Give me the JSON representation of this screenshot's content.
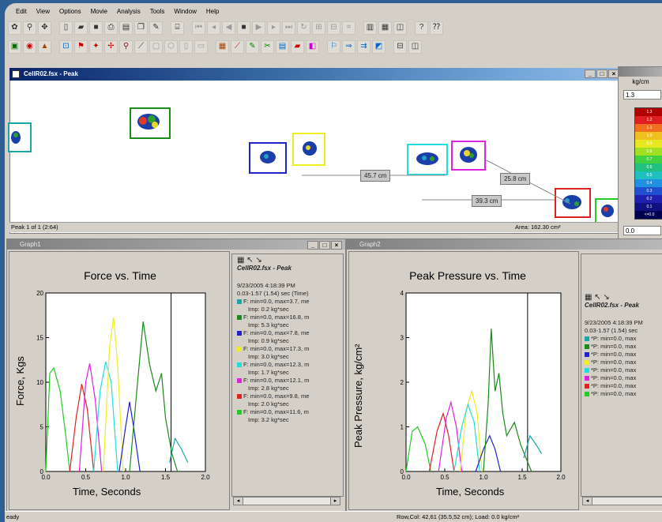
{
  "menu": [
    "Edit",
    "View",
    "Options",
    "Movie",
    "Analysis",
    "Tools",
    "Window",
    "Help"
  ],
  "main_window": {
    "title": "CellR02.fsx - Peak",
    "status_left": "Peak 1 of 1 (2:64)",
    "status_right": "Area: 162.30 cm²"
  },
  "measurements": [
    "45.7 cm",
    "25.8 cm",
    "39.3 cm"
  ],
  "scale_window": {
    "unit": "kg/cm",
    "top_value": "1.3",
    "bottom_value": "0.0",
    "labels": [
      "1.3",
      "1.2",
      "1.1",
      "1.0",
      "0.9",
      "0.8",
      "0.7",
      "0.6",
      "0.5",
      "0.4",
      "0.3",
      "0.2",
      "0.1",
      "<=0.0"
    ]
  },
  "graph1": {
    "window_title": "Graph1",
    "legend_header": "CellR02.fsx - Peak",
    "legend_date": "9/23/2005 4:18:39 PM",
    "legend_range": "0.03-1.57 (1.54) sec (Time)",
    "legend_items": [
      {
        "color": "#1aa6a6",
        "line": "F: min=0.0, max=3.7, me",
        "imp": "Imp: 0.2 kg*sec"
      },
      {
        "color": "#1a8a1a",
        "line": "F: min=0.0, max=16.8, m",
        "imp": "Imp: 5.3 kg*sec"
      },
      {
        "color": "#2222cc",
        "line": "F: min=0.0, max=7.8, me",
        "imp": "Imp: 0.9 kg*sec"
      },
      {
        "color": "#eeee22",
        "line": "F: min=0.0, max=17.3, m",
        "imp": "Imp: 3.0 kg*sec"
      },
      {
        "color": "#22dddd",
        "line": "F: min=0.0, max=12.3, m",
        "imp": "Imp: 1.7 kg*sec"
      },
      {
        "color": "#dd22dd",
        "line": "F: min=0.0, max=12.1, m",
        "imp": "Imp: 2.8 kg*sec"
      },
      {
        "color": "#dd2222",
        "line": "F: min=0.0, max=9.8, me",
        "imp": "Imp: 2.0 kg*sec"
      },
      {
        "color": "#22cc22",
        "line": "F: min=0.0, max=11.6, m",
        "imp": "Imp: 3.2 kg*sec"
      }
    ]
  },
  "graph2": {
    "window_title": "Graph2",
    "legend_header": "CellR02.fsx - Peak",
    "legend_date": "9/23/2005 4:18:39 PM",
    "legend_range": "0.03-1.57 (1.54) sec",
    "legend_items": [
      {
        "color": "#1aa6a6",
        "line": "*P: min=0.0, max"
      },
      {
        "color": "#1a8a1a",
        "line": "*P: min=0.0, max"
      },
      {
        "color": "#2222cc",
        "line": "*P: min=0.0, max"
      },
      {
        "color": "#eeee22",
        "line": "*P: min=0.0, max"
      },
      {
        "color": "#22dddd",
        "line": "*P: min=0.0, max"
      },
      {
        "color": "#dd22dd",
        "line": "*P: min=0.0, max"
      },
      {
        "color": "#dd2222",
        "line": "*P: min=0.0, max"
      },
      {
        "color": "#22cc22",
        "line": "*P: min=0.0, max"
      }
    ]
  },
  "statusbar": {
    "left": "eady",
    "right": "Row,Col: 42,61 (35.5,52 cm); Load: 0.0 kg/cm²"
  },
  "chart_data": [
    {
      "type": "line",
      "title": "Force vs. Time",
      "xlabel": "Time, Seconds",
      "ylabel": "Force, Kgs",
      "xlim": [
        0,
        2
      ],
      "ylim": [
        0,
        20
      ],
      "xticks": [
        "0.0",
        "0.5",
        "1.0",
        "1.5",
        "2.0"
      ],
      "yticks": [
        "0",
        "5",
        "10",
        "15",
        "20"
      ],
      "cursor_x": 1.57,
      "series": [
        {
          "color": "#22cc22",
          "x": [
            0.0,
            0.05,
            0.1,
            0.18,
            0.25,
            0.3
          ],
          "y": [
            0,
            11,
            11.6,
            9,
            4,
            0
          ]
        },
        {
          "color": "#dd2222",
          "x": [
            0.3,
            0.38,
            0.45,
            0.52,
            0.6
          ],
          "y": [
            0,
            6,
            9.8,
            7,
            0
          ]
        },
        {
          "color": "#dd22dd",
          "x": [
            0.42,
            0.5,
            0.55,
            0.62,
            0.7
          ],
          "y": [
            0,
            10,
            12.1,
            8,
            0
          ]
        },
        {
          "color": "#22dddd",
          "x": [
            0.6,
            0.68,
            0.75,
            0.82,
            0.9
          ],
          "y": [
            0,
            9,
            12.3,
            10,
            0
          ]
        },
        {
          "color": "#eeee22",
          "x": [
            0.72,
            0.8,
            0.85,
            0.9,
            0.97
          ],
          "y": [
            0,
            14,
            17.3,
            12,
            0
          ]
        },
        {
          "color": "#2222cc",
          "x": [
            0.92,
            1.0,
            1.05,
            1.1,
            1.18
          ],
          "y": [
            0,
            5,
            7.8,
            5,
            0
          ]
        },
        {
          "color": "#1a8a1a",
          "x": [
            1.05,
            1.15,
            1.22,
            1.3,
            1.38,
            1.45,
            1.5,
            1.58,
            1.65
          ],
          "y": [
            0,
            10,
            16.8,
            12,
            9,
            11,
            6,
            2,
            0
          ]
        },
        {
          "color": "#1aa6a6",
          "x": [
            1.55,
            1.62,
            1.7,
            1.78
          ],
          "y": [
            1,
            3.7,
            2.5,
            1
          ]
        }
      ]
    },
    {
      "type": "line",
      "title": "Peak Pressure vs. Time",
      "xlabel": "Time, Seconds",
      "ylabel": "Peak Pressure, kg/cm²",
      "xlim": [
        0,
        2
      ],
      "ylim": [
        0,
        4
      ],
      "xticks": [
        "0.0",
        "0.5",
        "1.0",
        "1.5",
        "2.0"
      ],
      "yticks": [
        "0",
        "1",
        "2",
        "3",
        "4"
      ],
      "cursor_x": 1.57,
      "series": [
        {
          "color": "#22cc22",
          "x": [
            0.0,
            0.08,
            0.15,
            0.25,
            0.32
          ],
          "y": [
            0,
            0.9,
            1.0,
            0.6,
            0
          ]
        },
        {
          "color": "#dd2222",
          "x": [
            0.3,
            0.4,
            0.48,
            0.55,
            0.62
          ],
          "y": [
            0,
            0.9,
            1.3,
            0.8,
            0
          ]
        },
        {
          "color": "#dd22dd",
          "x": [
            0.42,
            0.52,
            0.58,
            0.65,
            0.72
          ],
          "y": [
            0,
            1.2,
            1.55,
            1.0,
            0
          ]
        },
        {
          "color": "#eeee22",
          "x": [
            0.7,
            0.78,
            0.85,
            0.92,
            0.98
          ],
          "y": [
            0,
            1.4,
            1.8,
            1.3,
            0
          ]
        },
        {
          "color": "#22dddd",
          "x": [
            0.62,
            0.72,
            0.8,
            0.88,
            0.95
          ],
          "y": [
            0,
            1.0,
            1.5,
            1.1,
            0
          ]
        },
        {
          "color": "#2222cc",
          "x": [
            0.9,
            1.0,
            1.08,
            1.15,
            1.22
          ],
          "y": [
            0,
            0.5,
            0.8,
            0.5,
            0
          ]
        },
        {
          "color": "#1a8a1a",
          "x": [
            1.0,
            1.06,
            1.1,
            1.15,
            1.2,
            1.25,
            1.3,
            1.4,
            1.48,
            1.55,
            1.62
          ],
          "y": [
            0,
            1.5,
            3.2,
            1.8,
            2.2,
            1.3,
            0.8,
            1.1,
            0.6,
            0.3,
            0
          ]
        },
        {
          "color": "#1aa6a6",
          "x": [
            1.52,
            1.6,
            1.68,
            1.75
          ],
          "y": [
            0.3,
            0.8,
            0.6,
            0.4
          ]
        }
      ]
    }
  ]
}
